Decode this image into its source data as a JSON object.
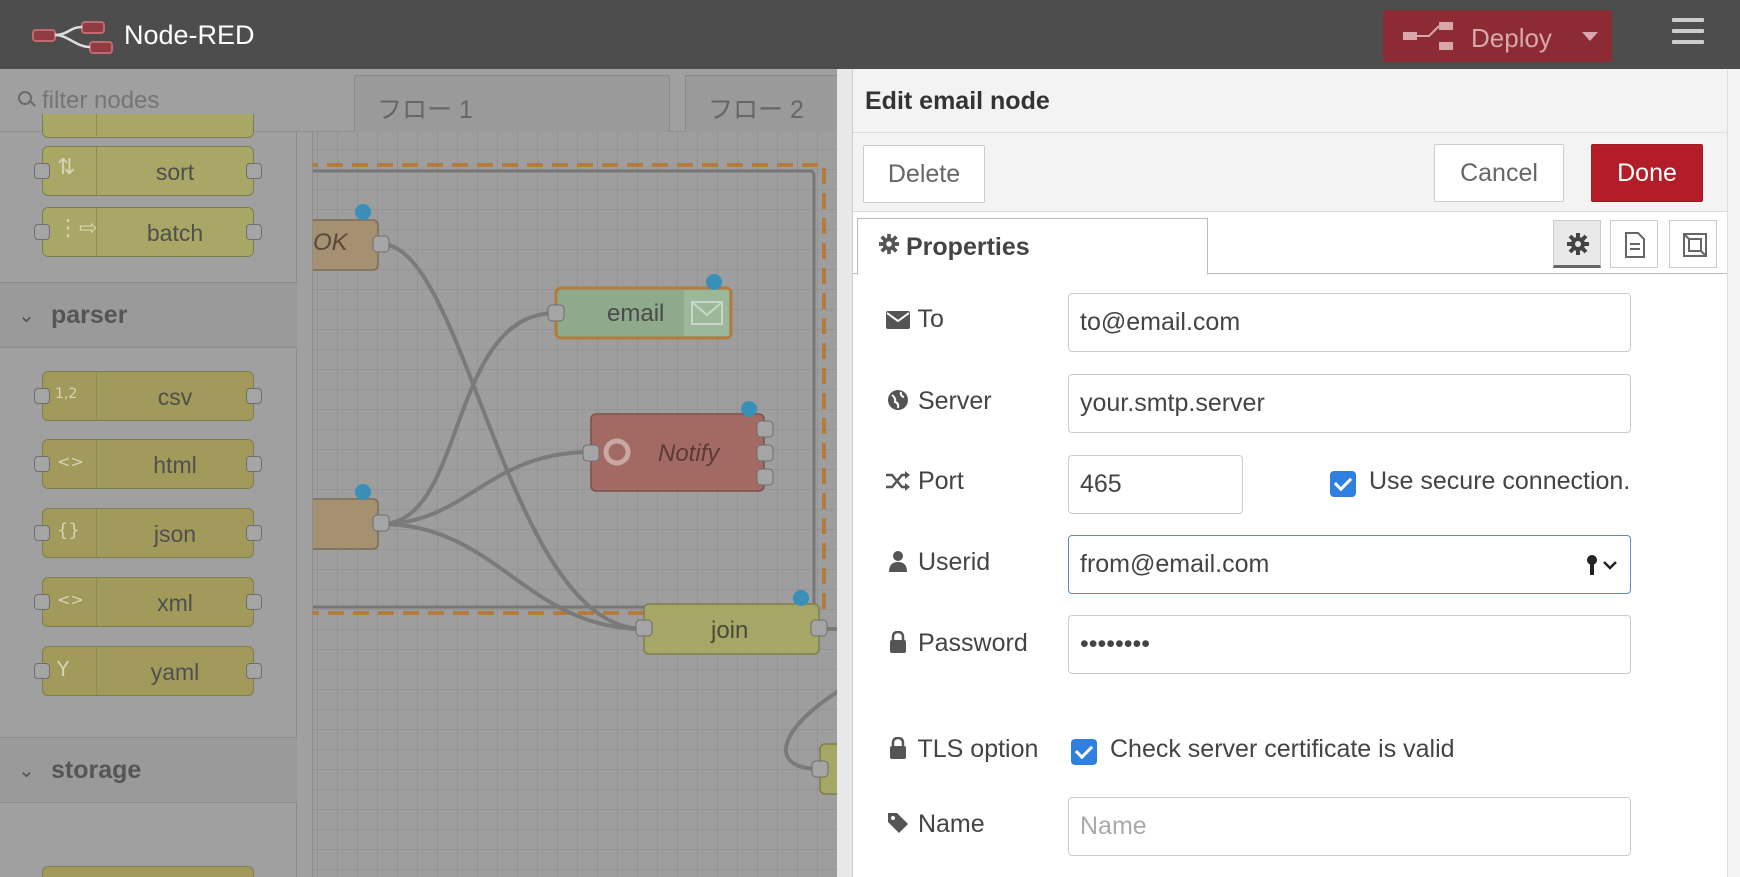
{
  "header": {
    "app_title": "Node-RED",
    "deploy_label": "Deploy",
    "colors": {
      "bar": "#4d4d4d",
      "deploy": "#8c2b33"
    }
  },
  "palette": {
    "filter_placeholder": "filter nodes",
    "function_nodes": [
      {
        "label": "sort",
        "icon": "sort-icon"
      },
      {
        "label": "batch",
        "icon": "batch-icon"
      }
    ],
    "parser_category": "parser",
    "parser_nodes": [
      {
        "label": "csv",
        "icon": "csv-icon"
      },
      {
        "label": "html",
        "icon": "html-icon"
      },
      {
        "label": "json",
        "icon": "json-icon"
      },
      {
        "label": "xml",
        "icon": "xml-icon"
      },
      {
        "label": "yaml",
        "icon": "yaml-icon"
      }
    ],
    "storage_category": "storage"
  },
  "workspace": {
    "tabs": [
      "フロー 1",
      "フロー 2"
    ],
    "nodes": {
      "ok_label": "OK",
      "email_label": "email",
      "notify_label": "Notify",
      "join_label": "join"
    }
  },
  "editor": {
    "title": "Edit email node",
    "delete_label": "Delete",
    "cancel_label": "Cancel",
    "done_label": "Done",
    "properties_tab": "Properties",
    "fields": {
      "to_label": "To",
      "to_value": "to@email.com",
      "server_label": "Server",
      "server_value": "your.smtp.server",
      "port_label": "Port",
      "port_value": "465",
      "secure_label": "Use secure connection.",
      "secure_checked": true,
      "userid_label": "Userid",
      "userid_value": "from@email.com",
      "password_label": "Password",
      "password_value": "••••••••",
      "tls_label": "TLS option",
      "tls_checkbox_label": "Check server certificate is valid",
      "tls_checked": true,
      "name_label": "Name",
      "name_placeholder": "Name"
    },
    "colors": {
      "done": "#b21d27",
      "checkbox": "#2f7fe0"
    }
  }
}
